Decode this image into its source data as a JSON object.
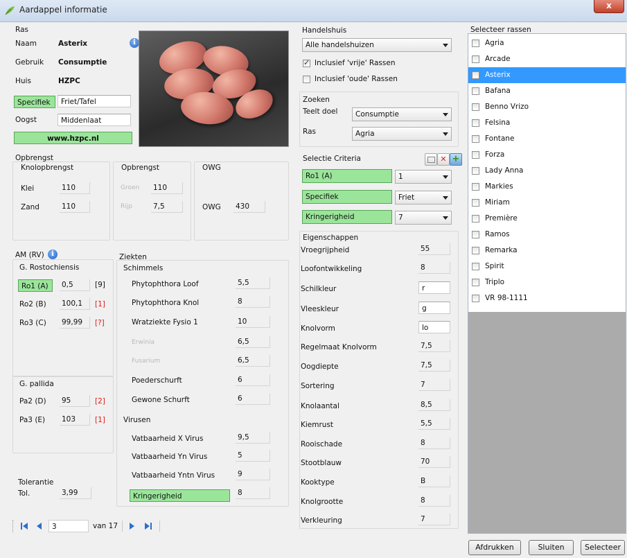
{
  "window": {
    "title": "Aardappel informatie",
    "close": "x"
  },
  "ras": {
    "section": "Ras",
    "naam_label": "Naam",
    "naam": "Asterix",
    "gebruik_label": "Gebruik",
    "gebruik": "Consumptie",
    "huis_label": "Huis",
    "huis": "HZPC",
    "specifiek_label": "Specifiek",
    "specifiek": "Friet/Tafel",
    "oogst_label": "Oogst",
    "oogst": "Middenlaat",
    "website": "www.hzpc.nl"
  },
  "opbrengst": {
    "section": "Opbrengst",
    "knol_title": "Knolopbrengst",
    "klei_label": "Klei",
    "klei": "110",
    "zand_label": "Zand",
    "zand": "110",
    "opb_title": "Opbrengst",
    "groen_label": "Groen",
    "groen": "110",
    "rijp_label": "Rijp",
    "rijp": "7,5",
    "owg_title": "OWG",
    "owg_label": "OWG",
    "owg": "430"
  },
  "am": {
    "section": "AM (RV)",
    "rosto_title": "G. Rostochiensis",
    "rows": [
      {
        "label": "Ro1 (A)",
        "value": "0,5",
        "flag": "[9]"
      },
      {
        "label": "Ro2 (B)",
        "value": "100,1",
        "flag": "[1]"
      },
      {
        "label": "Ro3 (C)",
        "value": "99,99",
        "flag": "[?]"
      }
    ],
    "pallida_title": "G. pallida",
    "pallida": [
      {
        "label": "Pa2 (D)",
        "value": "95",
        "flag": "[2]"
      },
      {
        "label": "Pa3 (E)",
        "value": "103",
        "flag": "[1]"
      }
    ]
  },
  "tolerantie": {
    "section": "Tolerantie",
    "label": "Tol.",
    "value": "3,99"
  },
  "ziekten": {
    "section": "Ziekten",
    "schimmels_title": "Schimmels",
    "items": [
      {
        "label": "Phytophthora Loof",
        "value": "5,5"
      },
      {
        "label": "Phytophthora Knol",
        "value": "8"
      },
      {
        "label": "Wratziekte Fysio 1",
        "value": "10"
      },
      {
        "label": "Erwinia",
        "value": "6,5"
      },
      {
        "label": "Fusarium",
        "value": "6,5"
      },
      {
        "label": "Poederschurft",
        "value": "6"
      },
      {
        "label": "Gewone Schurft",
        "value": "6"
      }
    ],
    "virusen_title": "Virusen",
    "virus": [
      {
        "label": "Vatbaarheid X Virus",
        "value": "9,5"
      },
      {
        "label": "Vatbaarheid Yn Virus",
        "value": "5"
      },
      {
        "label": "Vatbaarheid Yntn Virus",
        "value": "9"
      }
    ],
    "kring_label": "Kringerigheid",
    "kring_value": "8"
  },
  "handelshuis": {
    "section": "Handelshuis",
    "select": "Alle handelshuizen",
    "vrije": "Inclusief 'vrije' Rassen",
    "vrije_checked": true,
    "oude": "Inclusief 'oude' Rassen",
    "oude_checked": false
  },
  "zoeken": {
    "section": "Zoeken",
    "teelt_label": "Teelt doel",
    "teelt": "Consumptie",
    "ras_label": "Ras",
    "ras": "Agria"
  },
  "selectie": {
    "section": "Selectie Criteria",
    "rows": [
      {
        "label": "Ro1 (A)",
        "value": "1"
      },
      {
        "label": "Specifiek",
        "value": "Friet"
      },
      {
        "label": "Kringerigheid",
        "value": "7"
      }
    ]
  },
  "eigenschappen": {
    "section": "Eigenschappen",
    "items": [
      {
        "label": "Vroegrijpheid",
        "value": "55"
      },
      {
        "label": "Loofontwikkeling",
        "value": "8"
      },
      {
        "label": "Schilkleur",
        "value": "r"
      },
      {
        "label": "Vleeskleur",
        "value": "g"
      },
      {
        "label": "Knolvorm",
        "value": "lo"
      },
      {
        "label": "Regelmaat Knolvorm",
        "value": "7,5"
      },
      {
        "label": "Oogdiepte",
        "value": "7,5"
      },
      {
        "label": "Sortering",
        "value": "7"
      },
      {
        "label": "Knolaantal",
        "value": "8,5"
      },
      {
        "label": "Kiemrust",
        "value": "5,5"
      },
      {
        "label": "Rooischade",
        "value": "8"
      },
      {
        "label": "Stootblauw",
        "value": "70"
      },
      {
        "label": "Kooktype",
        "value": "B"
      },
      {
        "label": "Knolgrootte",
        "value": "8"
      },
      {
        "label": "Verkleuring",
        "value": "7"
      }
    ]
  },
  "rassen": {
    "section": "Selecteer rassen",
    "items": [
      "Agria",
      "Arcade",
      "Asterix",
      "Bafana",
      "Benno Vrizo",
      "Felsina",
      "Fontane",
      "Forza",
      "Lady Anna",
      "Markies",
      "Miriam",
      "Première",
      "Ramos",
      "Remarka",
      "Spirit",
      "Triplo",
      "VR 98-1111"
    ],
    "selected_index": 2
  },
  "nav": {
    "current": "3",
    "of_label": "van 17"
  },
  "buttons": {
    "print": "Afdrukken",
    "close": "Sluiten",
    "select": "Selecteer"
  },
  "colors": {
    "highlight": "#9be59b",
    "selection": "#3399ff",
    "flag": "#e01818"
  }
}
